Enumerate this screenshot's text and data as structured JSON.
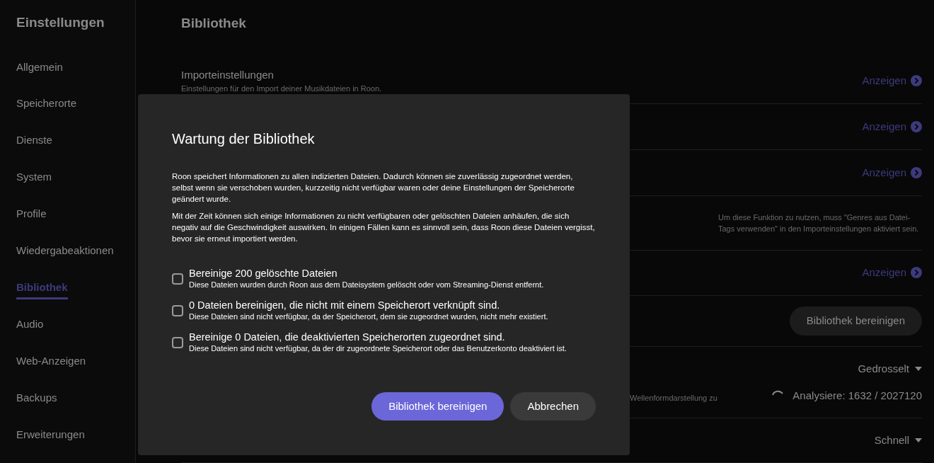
{
  "sidebar": {
    "title": "Einstellungen",
    "items": [
      {
        "label": "Allgemein",
        "selected": false
      },
      {
        "label": "Speicherorte",
        "selected": false
      },
      {
        "label": "Dienste",
        "selected": false
      },
      {
        "label": "System",
        "selected": false
      },
      {
        "label": "Profile",
        "selected": false
      },
      {
        "label": "Wiedergabeaktionen",
        "selected": false
      },
      {
        "label": "Bibliothek",
        "selected": true
      },
      {
        "label": "Audio",
        "selected": false
      },
      {
        "label": "Web-Anzeigen",
        "selected": false
      },
      {
        "label": "Backups",
        "selected": false
      },
      {
        "label": "Erweiterungen",
        "selected": false
      }
    ]
  },
  "page": {
    "title": "Bibliothek",
    "rows": [
      {
        "kind": "link",
        "title": "Importeinstellungen",
        "description": "Einstellungen für den Import deiner Musikdateien in Roon.",
        "action": "Anzeigen"
      },
      {
        "kind": "link",
        "action": "Anzeigen"
      },
      {
        "kind": "link",
        "action": "Anzeigen"
      },
      {
        "kind": "note",
        "note": "Um diese Funktion zu nutzen, muss \"Genres aus Datei-Tags verwenden\" in den Importeinstellungen aktiviert sein."
      },
      {
        "kind": "link",
        "action": "Anzeigen"
      },
      {
        "kind": "button",
        "action": "Bibliothek bereinigen"
      },
      {
        "kind": "analysis",
        "description": "Wellenformdarstellung zu",
        "action": "Gedrosselt",
        "status": "Analysiere: 1632 / 2027120"
      },
      {
        "kind": "dropdown",
        "action": "Schnell"
      }
    ]
  },
  "dialog": {
    "title": "Wartung der Bibliothek",
    "paragraphs": [
      "Roon speichert Informationen zu allen indizierten Dateien. Dadurch können sie zuverlässig zugeordnet werden, selbst wenn sie verschoben wurden, kurzzeitig nicht verfügbar waren oder deine Einstellungen der Speicherorte geändert wurde.",
      "Mit der Zeit können sich einige Informationen zu nicht verfügbaren oder gelöschten Dateien anhäufen, die sich negativ auf die Geschwindigkeit auswirken. In einigen Fällen kann es sinnvoll sein, dass Roon diese Dateien vergisst, bevor sie erneut importiert werden."
    ],
    "options": [
      {
        "label": "Bereinige 200 gelöschte Dateien",
        "description": "Diese Dateien wurden durch Roon aus dem Dateisystem gelöscht oder vom Streaming-Dienst entfernt.",
        "checked": false
      },
      {
        "label": "0 Dateien bereinigen, die nicht mit einem Speicherort verknüpft sind.",
        "description": "Diese Dateien sind nicht verfügbar, da der Speicherort, dem sie zugeordnet wurden, nicht mehr existiert.",
        "checked": false
      },
      {
        "label": "Bereinige 0 Dateien, die deaktivierten Speicherorten zugeordnet sind.",
        "description": "Diese Dateien sind nicht verfügbar, da der dir zugeordnete Speicherort oder das Benutzerkonto deaktiviert ist.",
        "checked": false
      }
    ],
    "primary_button": "Bibliothek bereinigen",
    "cancel_button": "Abbrechen"
  }
}
